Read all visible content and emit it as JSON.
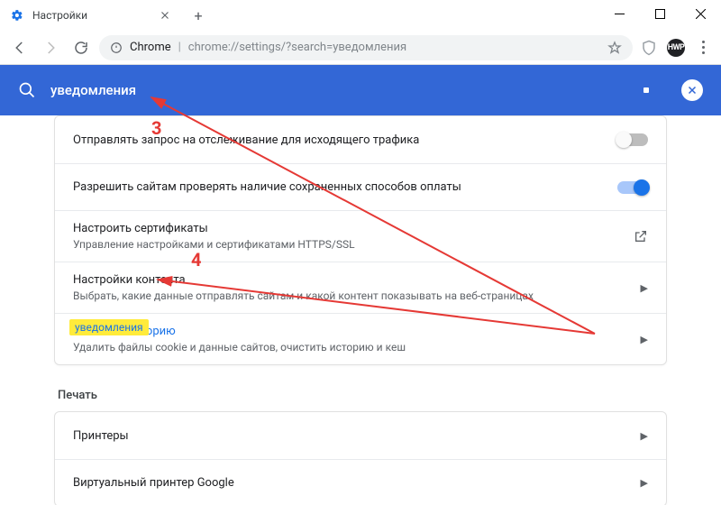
{
  "window": {
    "tab_title": "Настройки",
    "minimize": "–",
    "maximize": "▭",
    "close": "✕"
  },
  "toolbar": {
    "scheme_label": "Chrome",
    "url_path": "chrome://settings/?search=уведомления"
  },
  "badge_text": "HWP",
  "search": {
    "query": "уведомления",
    "clear": "✕"
  },
  "annotations": {
    "n3": "3",
    "n4": "4"
  },
  "rows": {
    "dnt": {
      "title": "Отправлять запрос на отслеживание для исходящего трафика"
    },
    "payments": {
      "title": "Разрешить сайтам проверять наличие сохраненных способов оплаты"
    },
    "certs": {
      "title": "Настроить сертификаты",
      "sub": "Управление настройками и сертификатами HTTPS/SSL"
    },
    "content": {
      "title": "Настройки контента",
      "sub": "Выбрать, какие данные отправлять сайтам и какой контент показывать на веб-страницах"
    },
    "clear": {
      "title": "Очистить историю",
      "sub": "Удалить файлы cookie и данные сайтов, очистить историю и кеш"
    },
    "highlight_label": "уведомления"
  },
  "print": {
    "header": "Печать",
    "printers": "Принтеры",
    "cloud": "Виртуальный принтер Google"
  }
}
